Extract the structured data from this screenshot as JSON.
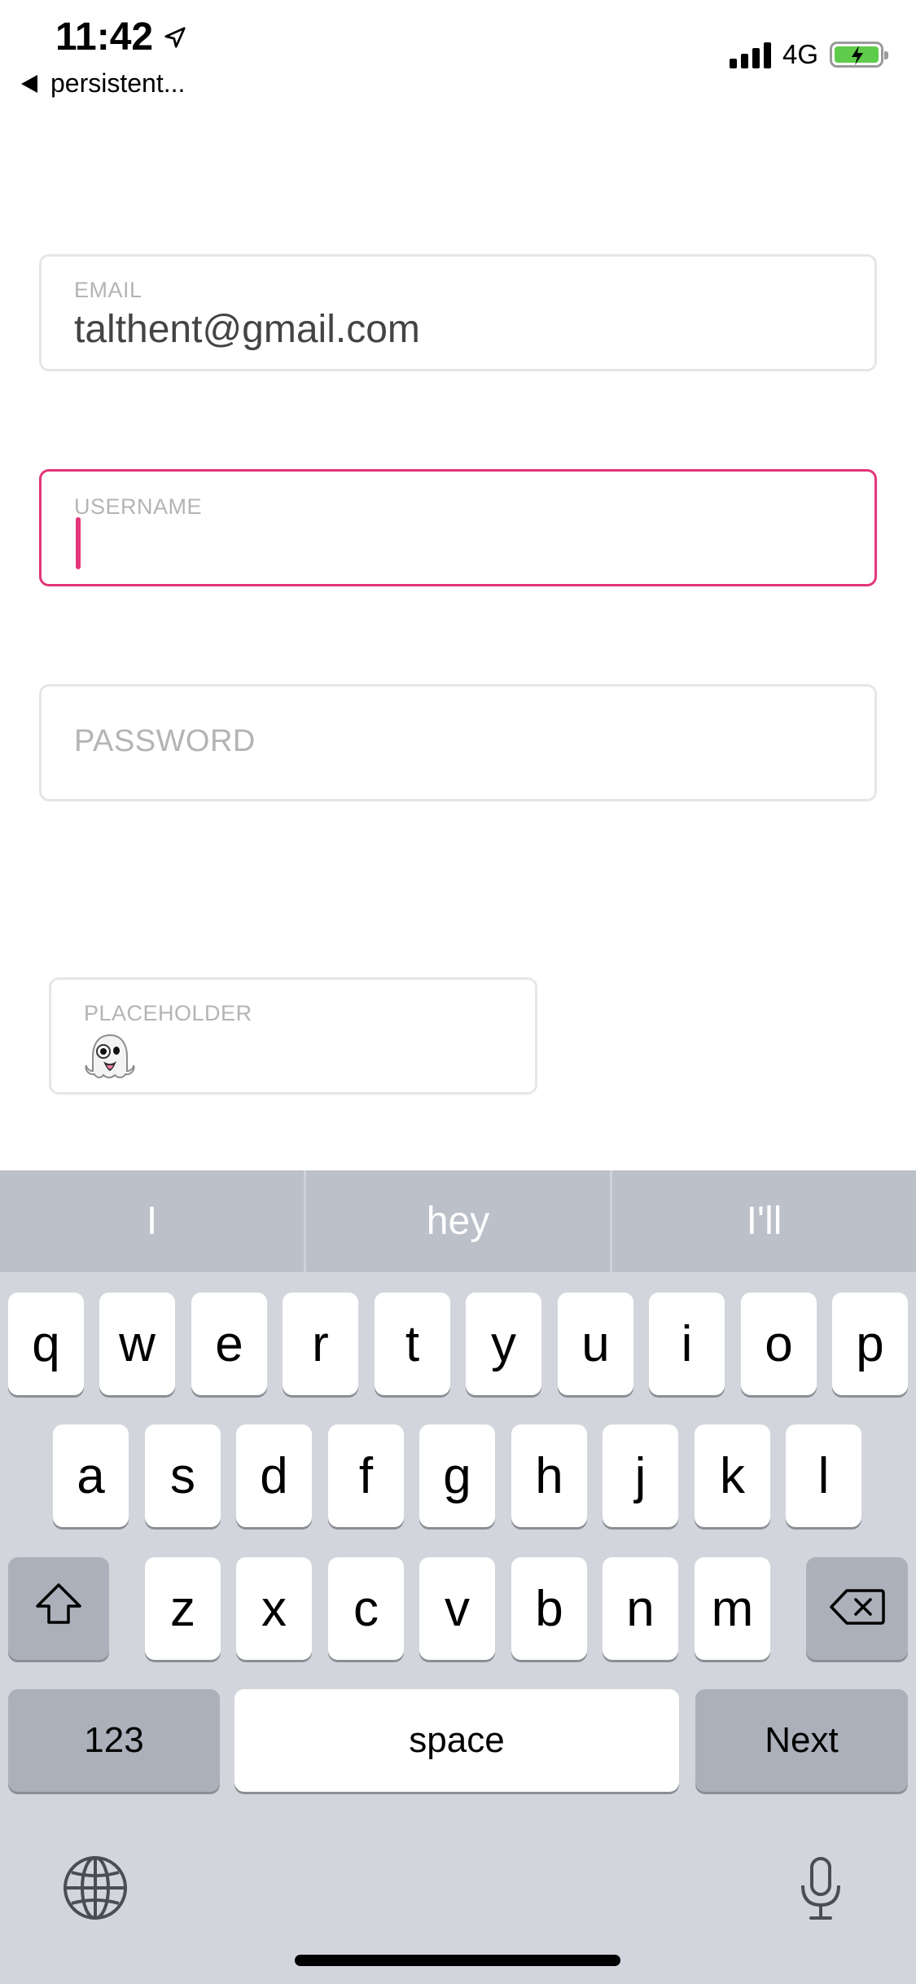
{
  "status_bar": {
    "time": "11:42",
    "back_app": "persistent...",
    "network": "4G",
    "location_icon": "location-arrow-icon",
    "signal_icon": "cellular-signal-icon",
    "battery_icon": "battery-charging-icon"
  },
  "form": {
    "email": {
      "label": "EMAIL",
      "value": "talthent@gmail.com"
    },
    "username": {
      "label": "USERNAME",
      "value": ""
    },
    "password": {
      "placeholder": "PASSWORD"
    },
    "placeholder_field": {
      "label": "PLACEHOLDER",
      "value_icon": "ghost-emoji-icon"
    }
  },
  "keyboard": {
    "suggestions": [
      "I",
      "hey",
      "I'll"
    ],
    "row1": [
      "q",
      "w",
      "e",
      "r",
      "t",
      "y",
      "u",
      "i",
      "o",
      "p"
    ],
    "row2": [
      "a",
      "s",
      "d",
      "f",
      "g",
      "h",
      "j",
      "k",
      "l"
    ],
    "row3": [
      "z",
      "x",
      "c",
      "v",
      "b",
      "n",
      "m"
    ],
    "numbers_label": "123",
    "space_label": "space",
    "next_label": "Next",
    "icons": [
      "shift-icon",
      "delete-icon",
      "globe-icon",
      "microphone-icon"
    ]
  },
  "colors": {
    "accent": "#e3357a",
    "keyboard_bg": "#d2d5db",
    "suggestion_bar": "#bcc0c9",
    "special_key": "#abb0ba",
    "battery_green": "#5ecb4a"
  }
}
